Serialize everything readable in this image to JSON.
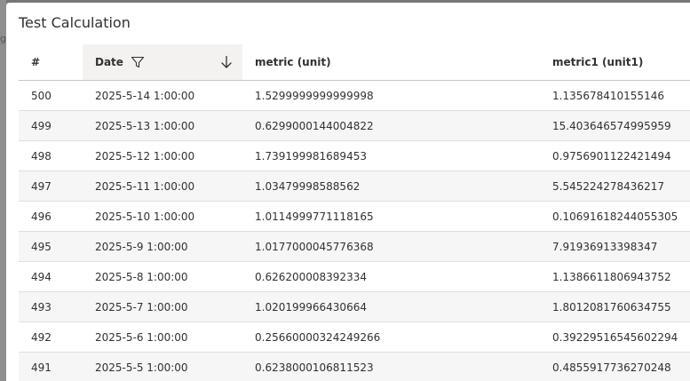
{
  "backdrop": {
    "fragment": "g"
  },
  "dialog": {
    "title": "Test Calculation"
  },
  "table": {
    "columns": {
      "number": "#",
      "date": "Date",
      "metric": "metric (unit)",
      "metric1": "metric1 (unit1)"
    },
    "rows": [
      {
        "num": "500",
        "date": "2025-5-14 1:00:00",
        "metric": "1.5299999999999998",
        "metric1": "1.135678410155146"
      },
      {
        "num": "499",
        "date": "2025-5-13 1:00:00",
        "metric": "0.6299000144004822",
        "metric1": "15.403646574995959"
      },
      {
        "num": "498",
        "date": "2025-5-12 1:00:00",
        "metric": "1.739199981689453",
        "metric1": "0.9756901122421494"
      },
      {
        "num": "497",
        "date": "2025-5-11 1:00:00",
        "metric": "1.03479998588562",
        "metric1": "5.545224278436217"
      },
      {
        "num": "496",
        "date": "2025-5-10 1:00:00",
        "metric": "1.0114999771118165",
        "metric1": "0.10691618244055305"
      },
      {
        "num": "495",
        "date": "2025-5-9 1:00:00",
        "metric": "1.0177000045776368",
        "metric1": "7.91936913398347"
      },
      {
        "num": "494",
        "date": "2025-5-8 1:00:00",
        "metric": "0.626200008392334",
        "metric1": "1.1386611806943752"
      },
      {
        "num": "493",
        "date": "2025-5-7 1:00:00",
        "metric": "1.020199966430664",
        "metric1": "1.8012081760634755"
      },
      {
        "num": "492",
        "date": "2025-5-6 1:00:00",
        "metric": "0.25660000324249266",
        "metric1": "0.39229516545602294"
      },
      {
        "num": "491",
        "date": "2025-5-5 1:00:00",
        "metric": "0.6238000106811523",
        "metric1": "0.4855917736270248"
      }
    ]
  },
  "icons": {
    "filter": "filter-icon",
    "sort": "sort-descending-icon"
  },
  "colors": {
    "header_active_bg": "#f3f2f1",
    "row_alt_bg": "#f6f6f6",
    "text": "#323130",
    "border": "#e1dfdd"
  }
}
